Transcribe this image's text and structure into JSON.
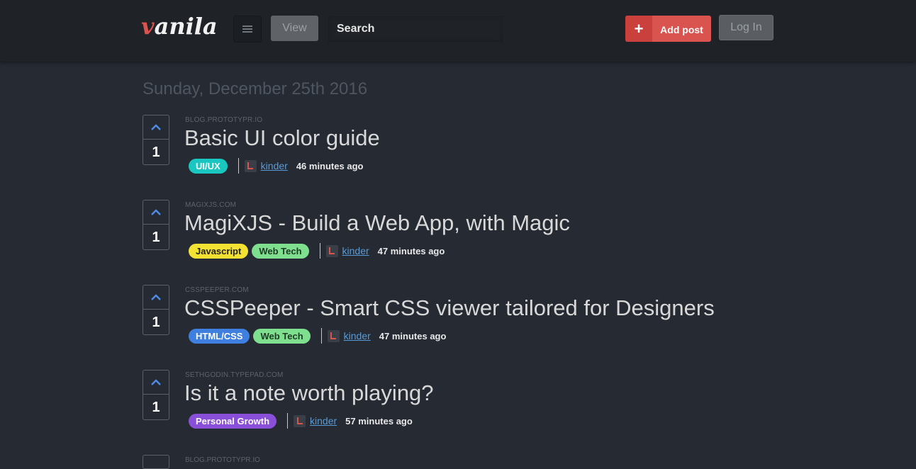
{
  "header": {
    "logo_first": "v",
    "logo_rest": "anila",
    "view_label": "View",
    "search_placeholder": "Search",
    "add_post_label": "Add post",
    "add_post_icon": "+",
    "login_label": "Log In"
  },
  "date_heading": "Sunday, December 25th 2016",
  "posts": [
    {
      "domain": "BLOG.PROTOTYPR.IO",
      "title": "Basic UI color guide",
      "votes": "1",
      "tags": [
        {
          "label": "UI/UX",
          "bg": "#19c6c0",
          "fg": "#ffffff"
        }
      ],
      "author": "kinder",
      "time": "46 minutes ago"
    },
    {
      "domain": "MAGIXJS.COM",
      "title": "MagiXJS - Build a Web App, with Magic",
      "votes": "1",
      "tags": [
        {
          "label": "Javascript",
          "bg": "#f3e232",
          "fg": "#222222"
        },
        {
          "label": "Web Tech",
          "bg": "#7ee08f",
          "fg": "#1f3a25"
        }
      ],
      "author": "kinder",
      "time": "47 minutes ago"
    },
    {
      "domain": "CSSPEEPER.COM",
      "title": "CSSPeeper - Smart CSS viewer tailored for Designers",
      "votes": "1",
      "tags": [
        {
          "label": "HTML/CSS",
          "bg": "#3f7fe0",
          "fg": "#ffffff"
        },
        {
          "label": "Web Tech",
          "bg": "#7ee08f",
          "fg": "#1f3a25"
        }
      ],
      "author": "kinder",
      "time": "47 minutes ago"
    },
    {
      "domain": "SETHGODIN.TYPEPAD.COM",
      "title": "Is it a note worth playing?",
      "votes": "1",
      "tags": [
        {
          "label": "Personal Growth",
          "bg": "#8a4fd8",
          "fg": "#ffffff"
        }
      ],
      "author": "kinder",
      "time": "57 minutes ago"
    }
  ],
  "partial_post_domain": "BLOG.PROTOTYPR.IO",
  "colors": {
    "background": "#252a33",
    "header_bg": "#1f2328",
    "accent_red": "#d9534f",
    "link_blue": "#5b9bd5",
    "upvote_blue": "#4f8be6"
  },
  "icons": {
    "menu": "hamburger-menu-icon",
    "upvote": "chevron-up-icon",
    "avatar": "user-avatar-icon",
    "add": "plus-icon"
  }
}
